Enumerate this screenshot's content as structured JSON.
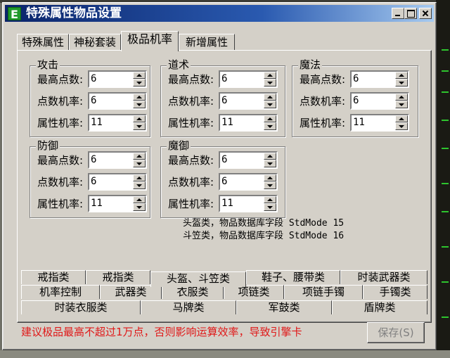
{
  "window": {
    "title": "特殊属性物品设置",
    "icon_letter": "E",
    "controls": {
      "minimize": "minimize-icon",
      "maximize": "maximize-icon",
      "close": "close-icon"
    }
  },
  "tabs": [
    {
      "label": "特殊属性"
    },
    {
      "label": "神秘套装"
    },
    {
      "label": "极品机率"
    },
    {
      "label": "新增属性"
    }
  ],
  "active_tab": "极品机率",
  "groups": {
    "attack": {
      "title": "攻击",
      "rows": [
        {
          "label": "最高点数:",
          "value": "6"
        },
        {
          "label": "点数机率:",
          "value": "6"
        },
        {
          "label": "属性机率:",
          "value": "11"
        }
      ]
    },
    "taoism": {
      "title": "道术",
      "rows": [
        {
          "label": "最高点数:",
          "value": "6"
        },
        {
          "label": "点数机率:",
          "value": "6"
        },
        {
          "label": "属性机率:",
          "value": "11"
        }
      ]
    },
    "magic": {
      "title": "魔法",
      "rows": [
        {
          "label": "最高点数:",
          "value": "6"
        },
        {
          "label": "点数机率:",
          "value": "6"
        },
        {
          "label": "属性机率:",
          "value": "11"
        }
      ]
    },
    "defense": {
      "title": "防御",
      "rows": [
        {
          "label": "最高点数:",
          "value": "6"
        },
        {
          "label": "点数机率:",
          "value": "6"
        },
        {
          "label": "属性机率:",
          "value": "11"
        }
      ]
    },
    "magic_defense": {
      "title": "魔御",
      "rows": [
        {
          "label": "最高点数:",
          "value": "6"
        },
        {
          "label": "点数机率:",
          "value": "6"
        },
        {
          "label": "属性机率:",
          "value": "11"
        }
      ]
    }
  },
  "notes": {
    "line1": "头盔类，物品数据库字段 StdMode 15",
    "line2": "斗笠类，物品数据库字段 StdMode 16"
  },
  "category_tabs": {
    "row1": [
      {
        "label": "戒指类"
      },
      {
        "label": "戒指类"
      },
      {
        "label": "头盔、斗笠类"
      },
      {
        "label": "鞋子、腰带类"
      },
      {
        "label": "时装武器类"
      }
    ],
    "row2": [
      {
        "label": "机率控制"
      },
      {
        "label": "武器类"
      },
      {
        "label": "衣服类"
      },
      {
        "label": "项链类"
      },
      {
        "label": "项链手镯"
      },
      {
        "label": "手镯类"
      }
    ],
    "row3": [
      {
        "label": "时装衣服类"
      },
      {
        "label": "马牌类"
      },
      {
        "label": "军鼓类"
      },
      {
        "label": "盾牌类"
      }
    ]
  },
  "active_category": "头盔、斗笠类",
  "warning": "建议极品最高不超过1万点，否则影响运算效率，导致引擎卡",
  "save_button": "保存(S)",
  "colors": {
    "title_bar": "#0a246a",
    "window_bg": "#d4d0c8",
    "warning_text": "#e01818",
    "app_icon": "#1f9a2a"
  }
}
